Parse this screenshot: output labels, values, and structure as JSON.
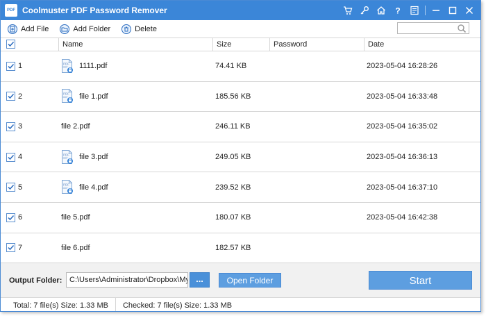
{
  "window": {
    "title": "Coolmuster PDF Password Remover",
    "logo_text": "PDF"
  },
  "titlebar_icons": [
    "cart-icon",
    "key-icon",
    "home-icon",
    "help-icon",
    "feedback-icon",
    "minimize-icon",
    "maximize-icon",
    "close-icon"
  ],
  "toolbar": {
    "add_file": "Add File",
    "add_folder": "Add Folder",
    "delete": "Delete",
    "search_placeholder": ""
  },
  "table": {
    "headers": {
      "name": "Name",
      "size": "Size",
      "password": "Password",
      "date": "Date"
    },
    "rows": [
      {
        "num": "1",
        "name": "1111.pdf",
        "size": "74.41 KB",
        "password": "",
        "date": "2023-05-04 16:28:26",
        "icon": true
      },
      {
        "num": "2",
        "name": "file 1.pdf",
        "size": "185.56 KB",
        "password": "",
        "date": "2023-05-04 16:33:48",
        "icon": true
      },
      {
        "num": "3",
        "name": "file 2.pdf",
        "size": "246.11 KB",
        "password": "",
        "date": "2023-05-04 16:35:02",
        "icon": false
      },
      {
        "num": "4",
        "name": "file 3.pdf",
        "size": "249.05 KB",
        "password": "",
        "date": "2023-05-04 16:36:13",
        "icon": true
      },
      {
        "num": "5",
        "name": "file 4.pdf",
        "size": "239.52 KB",
        "password": "",
        "date": "2023-05-04 16:37:10",
        "icon": true
      },
      {
        "num": "6",
        "name": "file 5.pdf",
        "size": "180.07 KB",
        "password": "",
        "date": "2023-05-04 16:42:38",
        "icon": false
      },
      {
        "num": "7",
        "name": "file 6.pdf",
        "size": "182.57 KB",
        "password": "",
        "date": "",
        "icon": false
      }
    ]
  },
  "bottom": {
    "output_label": "Output Folder:",
    "output_path": "C:\\Users\\Administrator\\Dropbox\\My PDF",
    "browse_label": "...",
    "open_folder": "Open Folder",
    "start": "Start"
  },
  "status": {
    "total": "Total: 7 file(s) Size: 1.33 MB",
    "checked": "Checked: 7 file(s) Size: 1.33 MB"
  },
  "colors": {
    "accent": "#3b86d8",
    "button": "#5d9ee0"
  }
}
